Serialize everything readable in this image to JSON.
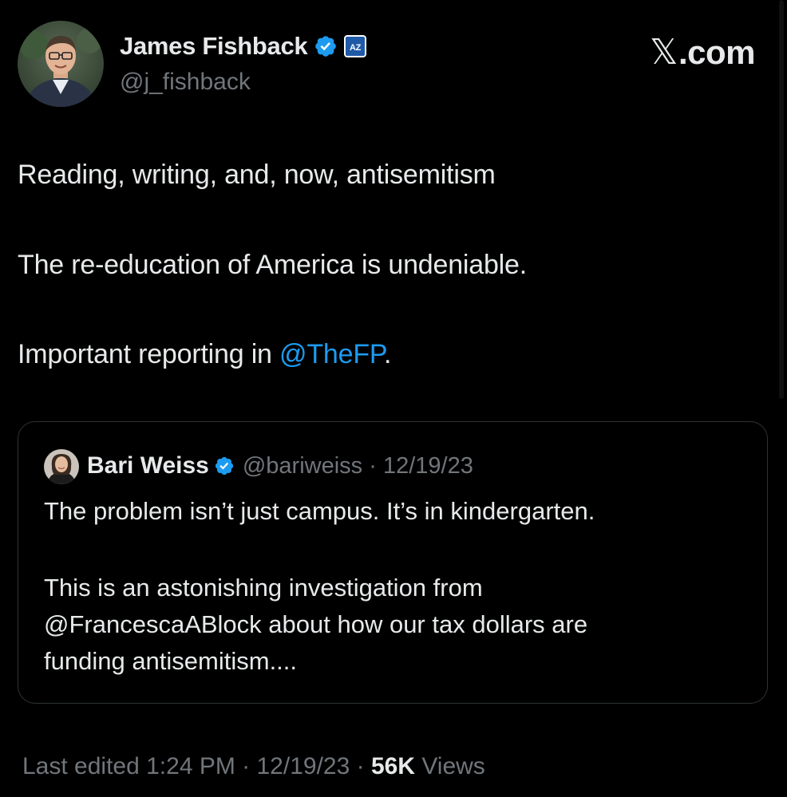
{
  "brand": {
    "icon": "x-logo-icon",
    "glyph": "𝕏",
    "label": ".com"
  },
  "author": {
    "name": "James Fishback",
    "handle": "@j_fishback",
    "verified_icon": "verified-badge-icon",
    "affiliate_badge_icon": "az-affiliate-badge-icon",
    "affiliate_badge_text": "AZ"
  },
  "tweet": {
    "line1": "Reading, writing, and, now, antisemitism",
    "line2": "The re-education of America is undeniable.",
    "line3_prefix": "Important reporting in ",
    "line3_mention": "@TheFP",
    "line3_suffix": "."
  },
  "quote": {
    "name": "Bari Weiss",
    "handle_date": "@bariweiss · 12/19/23",
    "verified_icon": "verified-badge-icon",
    "line1": "The problem isn’t just campus. It’s in kindergarten.",
    "line2": "This is an astonishing investigation from",
    "line3": "@FrancescaABlock about how our tax dollars are",
    "line4": "funding antisemitism...."
  },
  "footer": {
    "edited": "Last edited 1:24 PM · 12/19/23 · ",
    "views_count": "56K",
    "views_label": " Views"
  },
  "colors": {
    "background": "#000000",
    "text": "#e7e9ea",
    "muted": "#71767b",
    "accent": "#1d9bf0",
    "border": "#2f3336"
  }
}
